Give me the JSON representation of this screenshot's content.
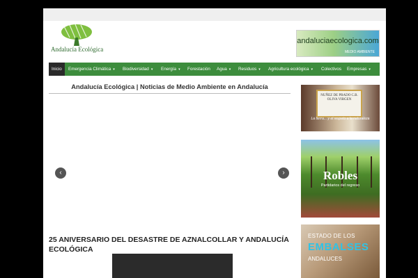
{
  "header": {
    "logo_text": "Andalucía   Ecológica",
    "banner_text": "andaluciaecologica.com",
    "banner_subtext": "MEDIO AMBIENTE"
  },
  "nav": {
    "items": [
      {
        "label": "Inicio",
        "dropdown": false,
        "active": true
      },
      {
        "label": "Emergencia Climática",
        "dropdown": true
      },
      {
        "label": "Biodiversidad",
        "dropdown": true
      },
      {
        "label": "Energía",
        "dropdown": true
      },
      {
        "label": "Forestación",
        "dropdown": false
      },
      {
        "label": "Agua",
        "dropdown": true
      },
      {
        "label": "Residuos",
        "dropdown": true
      },
      {
        "label": "Agricultura ecológica",
        "dropdown": true
      },
      {
        "label": "Colectivos",
        "dropdown": false
      },
      {
        "label": "Empresas",
        "dropdown": true
      }
    ],
    "caret": "▾"
  },
  "main": {
    "site_title": "Andalucía Ecológica | Noticias de Medio Ambiente en Andalucía",
    "slider": {
      "prev": "‹",
      "next": "›"
    },
    "post_title": "25 ANIVERSARIO DEL DESASTRE DE AZNALCOLLAR Y ANDALUCÍA ECOLÓGICA"
  },
  "sidebar": {
    "ad1": {
      "plaque": "NUÑEZ DE PRADO C.B. OLIVA VIRGEN",
      "slogan": "La tierra... y el respeto a la naturaleza"
    },
    "ad2": {
      "brand": "Robles",
      "tagline": "Partidarios del regreso"
    },
    "ad3": {
      "line1": "ESTADO DE LOS",
      "line2": "EMBALSES",
      "line3": "ANDALUCES"
    }
  },
  "colors": {
    "nav": "#3d8d3d",
    "active": "#2a2a2a",
    "accent": "#2fc3e6"
  }
}
